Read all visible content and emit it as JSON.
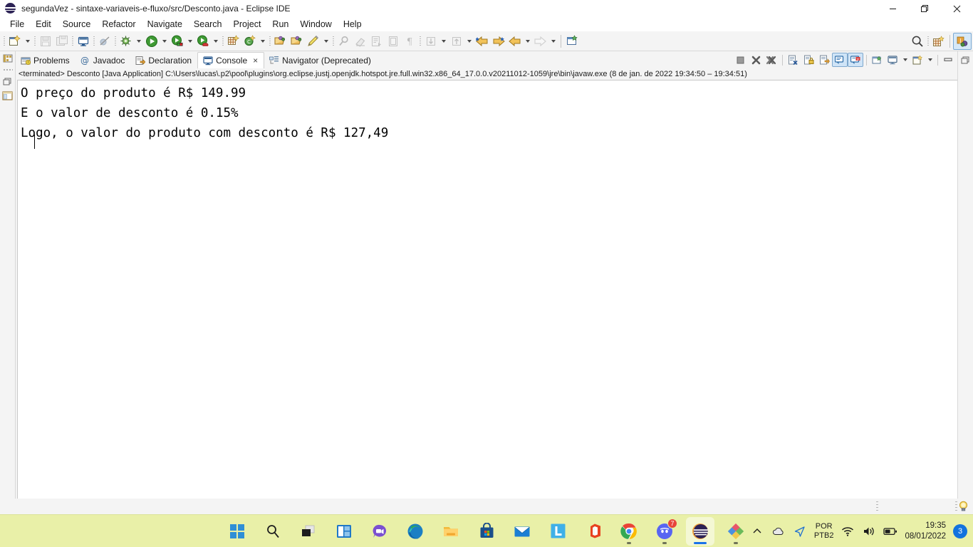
{
  "window": {
    "title": "segundaVez - sintaxe-variaveis-e-fluxo/src/Desconto.java - Eclipse IDE",
    "app_icon": "eclipse-sphere-icon",
    "controls": {
      "minimize": "minimize-icon",
      "maximize": "restore-icon",
      "close": "close-icon"
    }
  },
  "menubar": {
    "items": [
      {
        "label": "File"
      },
      {
        "label": "Edit"
      },
      {
        "label": "Source"
      },
      {
        "label": "Refactor"
      },
      {
        "label": "Navigate"
      },
      {
        "label": "Search"
      },
      {
        "label": "Project"
      },
      {
        "label": "Run"
      },
      {
        "label": "Window"
      },
      {
        "label": "Help"
      }
    ]
  },
  "toolbar": {
    "items": [
      {
        "name": "new-wizard-icon",
        "enabled": true
      },
      {
        "name": "save-icon",
        "enabled": false
      },
      {
        "name": "save-all-icon",
        "enabled": false
      },
      {
        "name": "open-console-icon",
        "enabled": true
      },
      {
        "name": "skip-all-breakpoints-icon",
        "enabled": false
      },
      {
        "name": "debug-icon",
        "enabled": true
      },
      {
        "name": "run-icon",
        "enabled": true
      },
      {
        "name": "run-external-tool-icon",
        "enabled": true
      },
      {
        "name": "coverage-icon",
        "enabled": true
      },
      {
        "name": "new-java-project-icon",
        "enabled": true
      },
      {
        "name": "new-java-class-icon",
        "enabled": true
      },
      {
        "name": "open-type-icon",
        "enabled": true
      },
      {
        "name": "open-task-icon",
        "enabled": true
      },
      {
        "name": "pencil-icon",
        "enabled": true
      },
      {
        "name": "search-marker-icon",
        "enabled": false
      },
      {
        "name": "eraser-icon",
        "enabled": false
      },
      {
        "name": "next-annotation-icon",
        "enabled": false
      },
      {
        "name": "block-selection-icon",
        "enabled": false
      },
      {
        "name": "show-whitespace-icon",
        "enabled": false
      },
      {
        "name": "last-edit-location-icon",
        "enabled": false
      },
      {
        "name": "previous-edit-icon",
        "enabled": false
      },
      {
        "name": "back-history-icon",
        "enabled": true
      },
      {
        "name": "forward-history-icon",
        "enabled": true
      },
      {
        "name": "previous-arrow-icon",
        "enabled": true
      },
      {
        "name": "next-arrow-icon",
        "enabled": false
      }
    ],
    "right": {
      "search": "search-icon",
      "open-perspective": "open-perspective-icon",
      "java-perspective": "java-perspective-icon"
    }
  },
  "views": {
    "tabs": [
      {
        "label": "Problems",
        "icon": "problems-icon",
        "active": false,
        "closable": false
      },
      {
        "label": "Javadoc",
        "icon": "javadoc-at-icon",
        "active": false,
        "closable": false
      },
      {
        "label": "Declaration",
        "icon": "declaration-icon",
        "active": false,
        "closable": false
      },
      {
        "label": "Console",
        "icon": "console-icon",
        "active": true,
        "closable": true
      },
      {
        "label": "Navigator (Deprecated)",
        "icon": "navigator-icon",
        "active": false,
        "closable": false
      }
    ],
    "tab_close_label": "×",
    "toolbar": [
      {
        "name": "terminate-icon",
        "toggled": false
      },
      {
        "name": "remove-launch-icon",
        "toggled": false
      },
      {
        "name": "remove-all-terminated-icon",
        "toggled": false
      },
      {
        "name": "clear-console-icon",
        "toggled": false
      },
      {
        "name": "scroll-lock-icon",
        "toggled": false
      },
      {
        "name": "word-wrap-icon",
        "toggled": false
      },
      {
        "name": "show-console-on-output-icon",
        "toggled": true
      },
      {
        "name": "show-console-on-error-icon",
        "toggled": true
      },
      {
        "name": "pin-console-icon",
        "toggled": false
      },
      {
        "name": "display-selected-console-icon",
        "toggled": false
      },
      {
        "name": "open-console-menu-icon",
        "toggled": false
      },
      {
        "name": "minimize-view-icon",
        "toggled": false
      },
      {
        "name": "maximize-view-icon",
        "toggled": false
      }
    ]
  },
  "console": {
    "header": "<terminated> Desconto [Java Application] C:\\Users\\lucas\\.p2\\pool\\plugins\\org.eclipse.justj.openjdk.hotspot.jre.full.win32.x86_64_17.0.0.v20211012-1059\\jre\\bin\\javaw.exe  (8 de jan. de 2022 19:34:50 – 19:34:51)",
    "lines": [
      "O preço do produto é R$ 149.99",
      "E o valor de desconto é 0.15%",
      "Logo, o valor do produto com desconto é R$ 127,49"
    ],
    "text_color": "#000000",
    "background": "#ffffff"
  },
  "statusbar": {
    "hint_icon": "lightbulb-icon"
  },
  "taskbar": {
    "background": "#e9f0a8",
    "items": [
      {
        "name": "start-button-icon",
        "label": "Start",
        "running": false
      },
      {
        "name": "search-taskbar-icon",
        "label": "Search",
        "running": false
      },
      {
        "name": "task-view-icon",
        "label": "Task View",
        "running": false
      },
      {
        "name": "widgets-icon",
        "label": "Widgets",
        "running": false
      },
      {
        "name": "chat-teams-icon",
        "label": "Chat",
        "running": false
      },
      {
        "name": "microsoft-edge-icon",
        "label": "Microsoft Edge",
        "running": false
      },
      {
        "name": "file-explorer-icon",
        "label": "File Explorer",
        "running": false
      },
      {
        "name": "microsoft-store-icon",
        "label": "Microsoft Store",
        "running": false
      },
      {
        "name": "mail-icon",
        "label": "Mail",
        "running": false
      },
      {
        "name": "lightshot-icon",
        "label": "Lightshot",
        "running": false
      },
      {
        "name": "microsoft-office-icon",
        "label": "Office",
        "running": false
      },
      {
        "name": "google-chrome-icon",
        "label": "Google Chrome",
        "running": true,
        "badge": null
      },
      {
        "name": "discord-icon",
        "label": "Discord",
        "running": true,
        "badge": "7"
      },
      {
        "name": "eclipse-ide-icon",
        "label": "Eclipse IDE",
        "running": true,
        "active": true
      },
      {
        "name": "app-colors-icon",
        "label": "App",
        "running": true
      }
    ],
    "tray": {
      "chevron": "show-hidden-icons-icon",
      "cloud": "onedrive-icon",
      "location": "location-icon",
      "language": {
        "line1": "POR",
        "line2": "PTB2"
      },
      "wifi": "wifi-icon",
      "volume": "volume-icon",
      "battery": "battery-icon",
      "time": "19:35",
      "date": "08/01/2022",
      "notification_count": "3"
    }
  }
}
